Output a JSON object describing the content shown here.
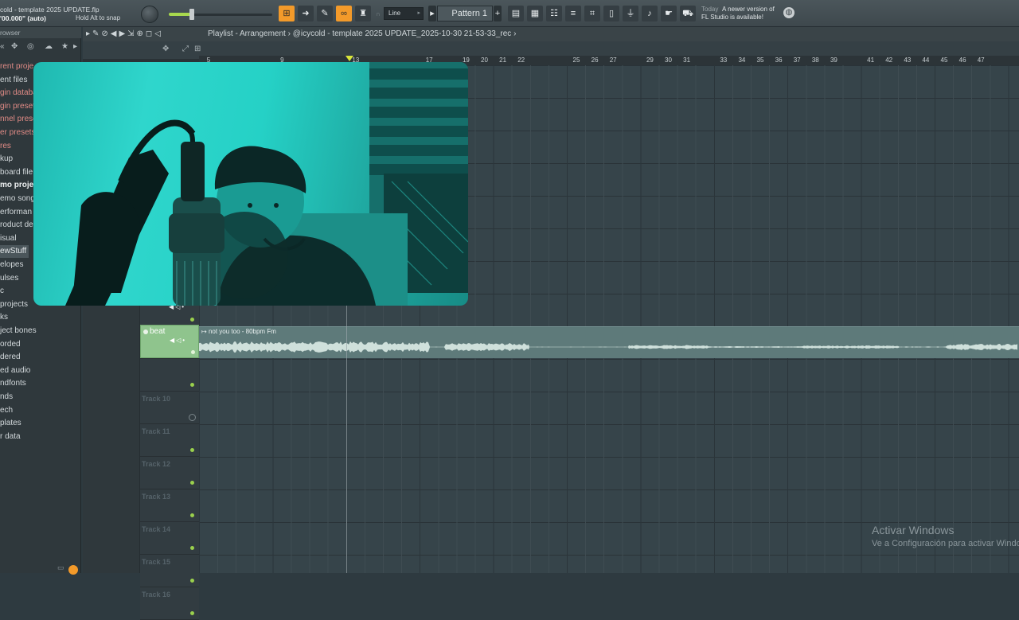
{
  "toolbar": {
    "project_title": "cold - template 2025 UPDATE.flp",
    "time_readout": "'00.000\" (auto)",
    "snap_hint": "Hold Alt to snap",
    "snap_mode": "Line",
    "pattern": "Pattern 1",
    "news_label": "Today",
    "news_line1": "A newer version of",
    "news_line2": "FL Studio is available!",
    "accent_color": "#f39a2a"
  },
  "browser": {
    "header": "rowser",
    "items": [
      {
        "label": "rent proje",
        "style": "red"
      },
      {
        "label": "ent files",
        "style": "normal"
      },
      {
        "label": "gin databa",
        "style": "red"
      },
      {
        "label": "gin preset",
        "style": "red"
      },
      {
        "label": "nnel prese",
        "style": "red"
      },
      {
        "label": "er presets",
        "style": "red"
      },
      {
        "label": "res",
        "style": "red"
      },
      {
        "label": "kup",
        "style": "normal"
      },
      {
        "label": "board file",
        "style": "normal"
      },
      {
        "label": "mo project",
        "style": "bold"
      },
      {
        "label": "emo song",
        "style": "normal"
      },
      {
        "label": "erforman",
        "style": "normal"
      },
      {
        "label": "roduct de",
        "style": "normal"
      },
      {
        "label": "isual",
        "style": "normal"
      },
      {
        "label": "ewStuff",
        "style": "sel"
      },
      {
        "label": "elopes",
        "style": "normal"
      },
      {
        "label": "ulses",
        "style": "normal"
      },
      {
        "label": "c",
        "style": "normal"
      },
      {
        "label": "projects",
        "style": "normal"
      },
      {
        "label": "ks",
        "style": "normal"
      },
      {
        "label": "ject bones",
        "style": "normal"
      },
      {
        "label": "orded",
        "style": "normal"
      },
      {
        "label": "dered",
        "style": "normal"
      },
      {
        "label": "ed audio",
        "style": "normal"
      },
      {
        "label": "ndfonts",
        "style": "normal"
      },
      {
        "label": "nds",
        "style": "normal"
      },
      {
        "label": "ech",
        "style": "normal"
      },
      {
        "label": "plates",
        "style": "normal"
      },
      {
        "label": "r data",
        "style": "normal"
      }
    ]
  },
  "playlist": {
    "title": "Playlist - Arrangement",
    "path": "@icycold - template 2025 UPDATE_2025-10-30 21-53-33_rec",
    "ruler_ticks": [
      "5",
      "9",
      "13",
      "17",
      "19",
      "20",
      "21",
      "22",
      "25",
      "26",
      "27",
      "29",
      "30",
      "31",
      "33",
      "34",
      "35",
      "36",
      "37",
      "38",
      "39",
      "41",
      "42",
      "43",
      "44",
      "45",
      "46",
      "47"
    ],
    "beat_track": "beat",
    "clip_title": "not you too - 80bpm Fm",
    "tracks": [
      "Track 10",
      "Track 11",
      "Track 12",
      "Track 13",
      "Track 14",
      "Track 15",
      "Track 16"
    ],
    "clip_color": "#8fc48d"
  },
  "watermark": {
    "line1": "Activar Windows",
    "line2": "Ve a Configuración para activar Windo"
  }
}
